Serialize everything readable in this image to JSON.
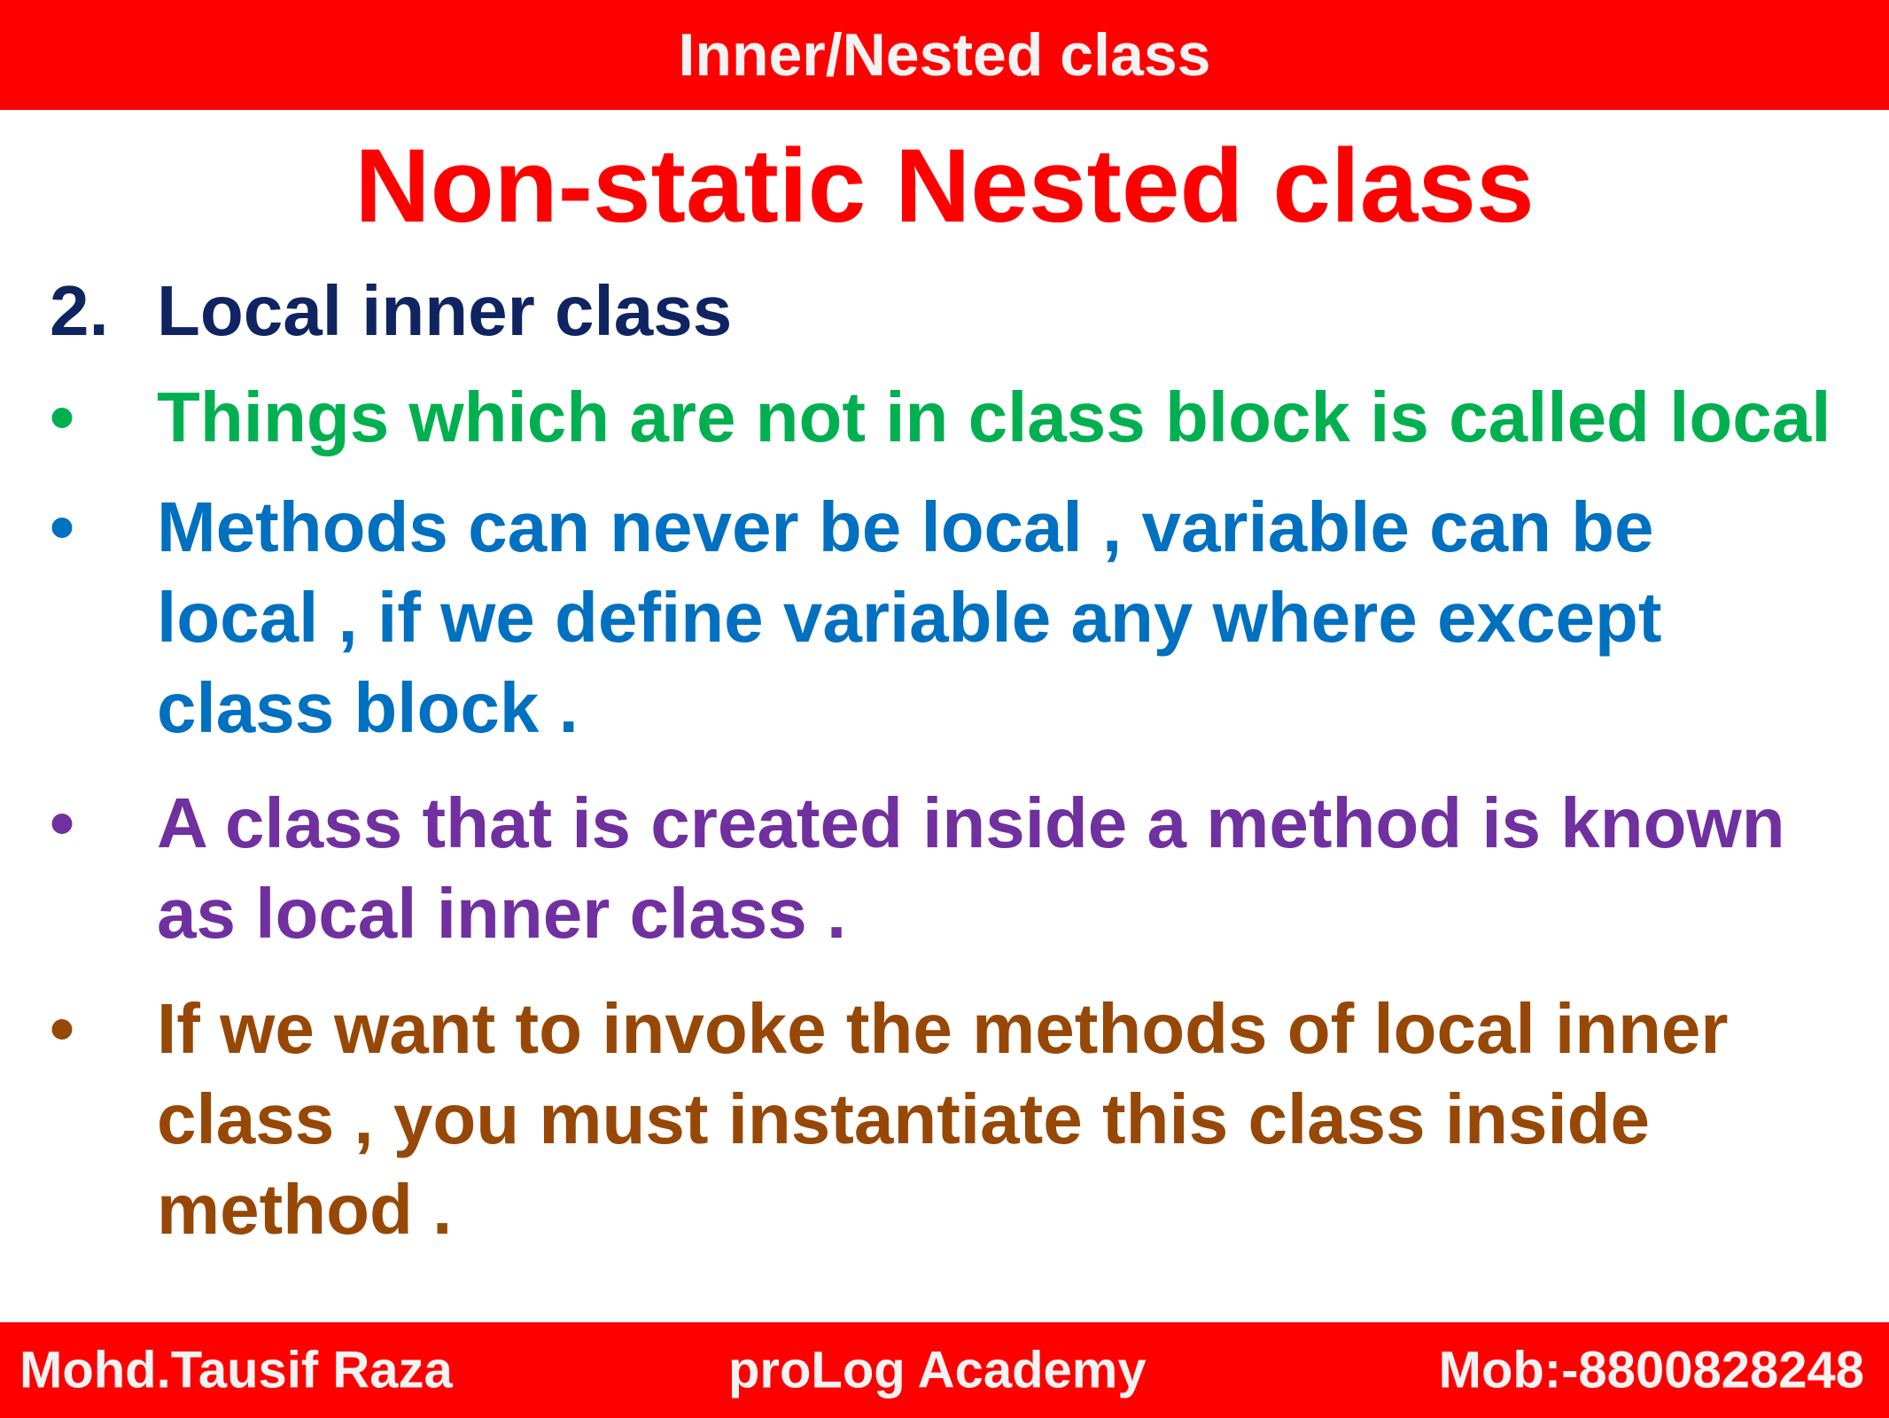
{
  "header": {
    "banner_title": "Inner/Nested class"
  },
  "slide": {
    "title": "Non-static Nested class",
    "heading": {
      "number": "2.",
      "text": "Local inner class"
    },
    "bullets": [
      {
        "marker": "•",
        "lines": [
          "Things which are not in class block is called local"
        ],
        "color": "#00b050"
      },
      {
        "marker": "•",
        "lines": [
          "Methods can never be local , variable can be",
          "local , if we define variable any where except",
          "class block ."
        ],
        "color": "#0070c0"
      },
      {
        "marker": "•",
        "lines": [
          "A class that is created inside a method is known",
          "as local inner class ."
        ],
        "color": "#7030a0"
      },
      {
        "marker": "•",
        "lines": [
          "If we want to invoke the methods of local inner",
          "class , you must instantiate this class inside",
          "method ."
        ],
        "color": "#974706"
      }
    ]
  },
  "footer": {
    "author": "Mohd.Tausif Raza",
    "academy": "proLog Academy",
    "phone": "Mob:-8800828248"
  },
  "colors": {
    "banner": "#ff0000",
    "title": "#ff0000",
    "heading": "#0f2461"
  }
}
